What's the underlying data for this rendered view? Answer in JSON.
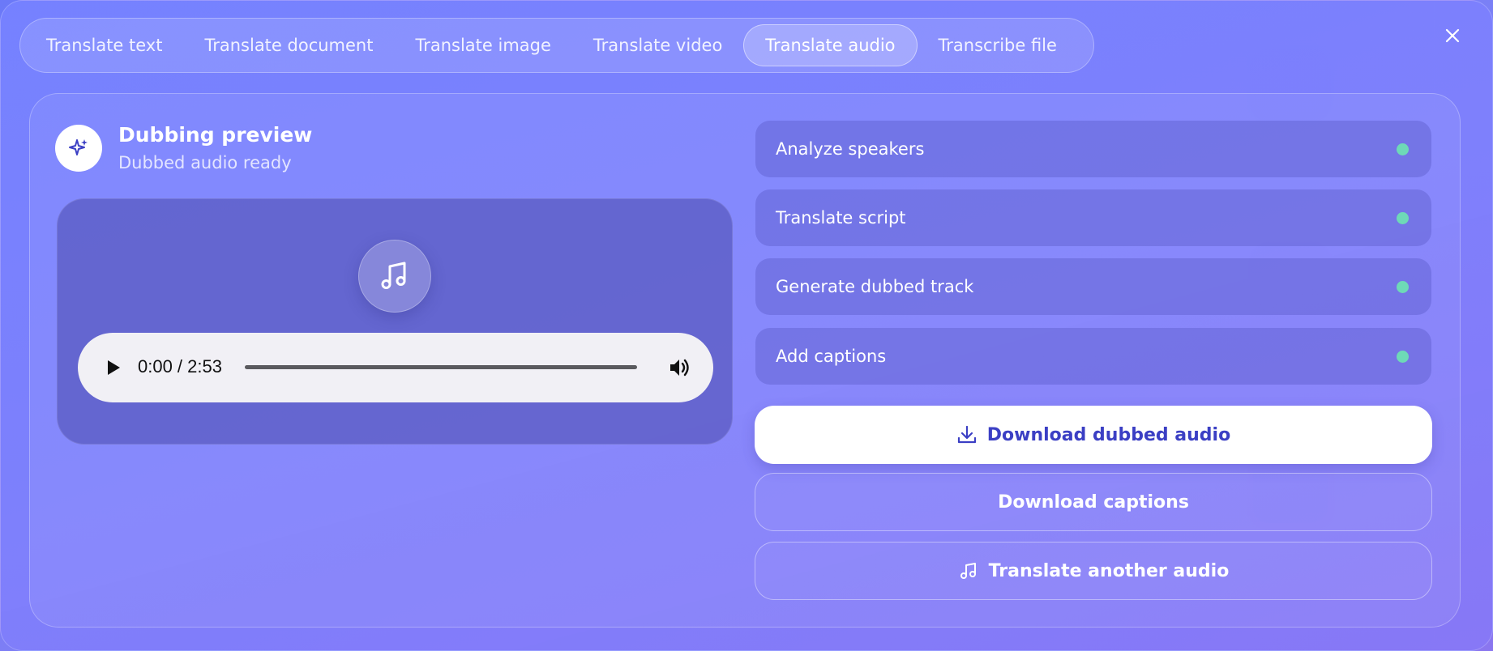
{
  "tabs": [
    {
      "label": "Translate text"
    },
    {
      "label": "Translate document"
    },
    {
      "label": "Translate image"
    },
    {
      "label": "Translate video"
    },
    {
      "label": "Translate audio",
      "active": true
    },
    {
      "label": "Transcribe file"
    }
  ],
  "preview": {
    "title": "Dubbing preview",
    "subtitle": "Dubbed audio ready",
    "icon": "sparkle-icon",
    "media_icon": "music-note-icon"
  },
  "player": {
    "time": "0:00 / 2:53",
    "progress": 0
  },
  "steps": [
    {
      "label": "Analyze speakers",
      "status": "done"
    },
    {
      "label": "Translate script",
      "status": "done"
    },
    {
      "label": "Generate dubbed track",
      "status": "done"
    },
    {
      "label": "Add captions",
      "status": "done"
    }
  ],
  "actions": {
    "download_audio": "Download dubbed audio",
    "download_captions": "Download captions",
    "translate_another": "Translate another audio"
  },
  "colors": {
    "accent": "#3b3fc4",
    "status_done": "#6ed9b7",
    "modal_bg": "#7a80f6"
  }
}
